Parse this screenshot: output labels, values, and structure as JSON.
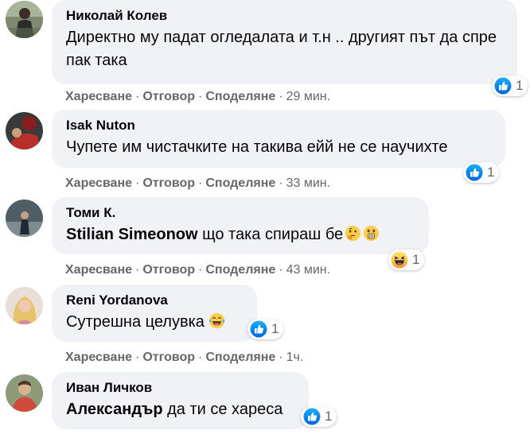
{
  "comments": [
    {
      "author": "Николай Колев",
      "text": "Директно му падат огледалата и т.н .. другият път да спре пак така",
      "reaction": {
        "icon": "like-icon",
        "count": "1"
      },
      "actions": {
        "like": "Харесване",
        "reply": "Отговор",
        "share": "Споделяне",
        "time": "29 мин."
      }
    },
    {
      "author": "Isak Nuton",
      "text": "Чупете им чистачките на такива ейй не се научихте",
      "reaction": {
        "icon": "like-icon",
        "count": "1"
      },
      "actions": {
        "like": "Харесване",
        "reply": "Отговор",
        "share": "Споделяне",
        "time": "33 мин."
      }
    },
    {
      "author": "Томи К.",
      "mention": "Stilian Simeonow",
      "text": "що така спираш бе",
      "emojis": [
        "thinking-face-icon",
        "screaming-face-icon"
      ],
      "reaction": {
        "icon": "haha-icon",
        "count": "1"
      },
      "actions": {
        "like": "Харесване",
        "reply": "Отговор",
        "share": "Споделяне",
        "time": "43 мин."
      }
    },
    {
      "author": "Reni Yordanova",
      "text": "Сутрешна целувка",
      "emojis": [
        "laughing-tears-icon"
      ],
      "reaction": {
        "icon": "like-icon",
        "count": "1"
      },
      "actions": {
        "like": "Харесване",
        "reply": "Отговор",
        "share": "Споделяне",
        "time": "1ч."
      }
    },
    {
      "author": "Иван Личков",
      "mention": "Александър",
      "text": "да ти се хареса",
      "reaction": {
        "icon": "like-icon",
        "count": "1"
      }
    }
  ],
  "colors": {
    "bubble": "#f0f2f5",
    "meta_text": "#65676b",
    "body_text": "#050505",
    "like_blue": "#1877f2"
  }
}
